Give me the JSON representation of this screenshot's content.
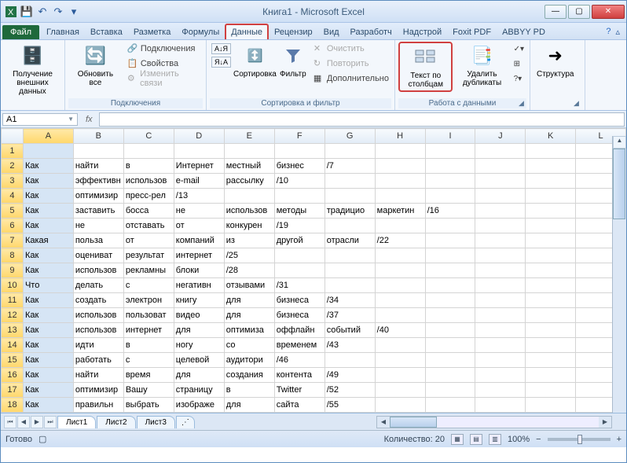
{
  "title": "Книга1 - Microsoft Excel",
  "tabs": {
    "file": "Файл",
    "home": "Главная",
    "insert": "Вставка",
    "layout": "Разметка",
    "formulas": "Формулы",
    "data": "Данные",
    "review": "Рецензир",
    "view": "Вид",
    "dev": "Разработч",
    "addins": "Надстрой",
    "foxit": "Foxit PDF",
    "abbyy": "ABBYY PD"
  },
  "ribbon": {
    "extdata": "Получение внешних данных",
    "refresh": "Обновить все",
    "conn_group": "Подключения",
    "conn": "Подключения",
    "props": "Свойства",
    "editlinks": "Изменить связи",
    "sort": "Сортировка",
    "filter": "Фильтр",
    "clear": "Очистить",
    "reapply": "Повторить",
    "adv": "Дополнительно",
    "sortfilter_group": "Сортировка и фильтр",
    "t2c": "Текст по столбцам",
    "dedup": "Удалить дубликаты",
    "tools_group": "Работа с данными",
    "outline": "Структура"
  },
  "namebox": "A1",
  "cols": [
    "A",
    "B",
    "C",
    "D",
    "E",
    "F",
    "G",
    "H",
    "I",
    "J",
    "K",
    "L"
  ],
  "rows": [
    [
      "",
      "",
      "",
      "",
      "",
      "",
      "",
      "",
      "",
      "",
      "",
      ""
    ],
    [
      "Как",
      "найти",
      "в",
      "Интернет",
      "местный",
      "бизнес",
      "/7",
      "",
      "",
      "",
      "",
      ""
    ],
    [
      "Как",
      "эффективн",
      "использов",
      "e-mail",
      "рассылку",
      "/10",
      "",
      "",
      "",
      "",
      "",
      ""
    ],
    [
      "Как",
      "оптимизир",
      "пресс-рел",
      "/13",
      "",
      "",
      "",
      "",
      "",
      "",
      "",
      ""
    ],
    [
      "Как",
      "заставить",
      "босса",
      "не",
      "использов",
      "методы",
      "традицио",
      "маркетин",
      "/16",
      "",
      "",
      ""
    ],
    [
      "Как",
      "не",
      "отставать",
      "от",
      "конкурен",
      "/19",
      "",
      "",
      "",
      "",
      "",
      ""
    ],
    [
      "Какая",
      "польза",
      "от",
      "компаний",
      "из",
      "другой",
      "отрасли",
      "/22",
      "",
      "",
      "",
      ""
    ],
    [
      "Как",
      "оцениват",
      "результат",
      "интернет",
      "/25",
      "",
      "",
      "",
      "",
      "",
      "",
      ""
    ],
    [
      "Как",
      "использов",
      "рекламны",
      "блоки",
      "/28",
      "",
      "",
      "",
      "",
      "",
      "",
      ""
    ],
    [
      "Что",
      "делать",
      "с",
      "негативн",
      "отзывами",
      "/31",
      "",
      "",
      "",
      "",
      "",
      ""
    ],
    [
      "Как",
      "создать",
      "электрон",
      "книгу",
      "для",
      "бизнеса",
      "/34",
      "",
      "",
      "",
      "",
      ""
    ],
    [
      "Как",
      "использов",
      "пользоват",
      "видео",
      "для",
      "бизнеса",
      "/37",
      "",
      "",
      "",
      "",
      ""
    ],
    [
      "Как",
      "использов",
      "интернет",
      "для",
      "оптимиза",
      "оффлайн",
      "событий",
      "/40",
      "",
      "",
      "",
      ""
    ],
    [
      "Как",
      "идти",
      "в",
      "ногу",
      "со",
      "временем",
      "/43",
      "",
      "",
      "",
      "",
      ""
    ],
    [
      "Как",
      "работать",
      "с",
      "целевой",
      "аудитори",
      "/46",
      "",
      "",
      "",
      "",
      "",
      ""
    ],
    [
      "Как",
      "найти",
      "время",
      "для",
      "создания",
      "контента",
      "/49",
      "",
      "",
      "",
      "",
      ""
    ],
    [
      "Как",
      "оптимизир",
      "Вашу",
      "страницу",
      "в",
      "Twitter",
      "/52",
      "",
      "",
      "",
      "",
      ""
    ],
    [
      "Как",
      "правильн",
      "выбрать",
      "изображе",
      "для",
      "сайта",
      "/55",
      "",
      "",
      "",
      "",
      ""
    ]
  ],
  "sheets": {
    "s1": "Лист1",
    "s2": "Лист2",
    "s3": "Лист3"
  },
  "status": {
    "ready": "Готово",
    "count": "Количество: 20",
    "zoom": "100%"
  }
}
